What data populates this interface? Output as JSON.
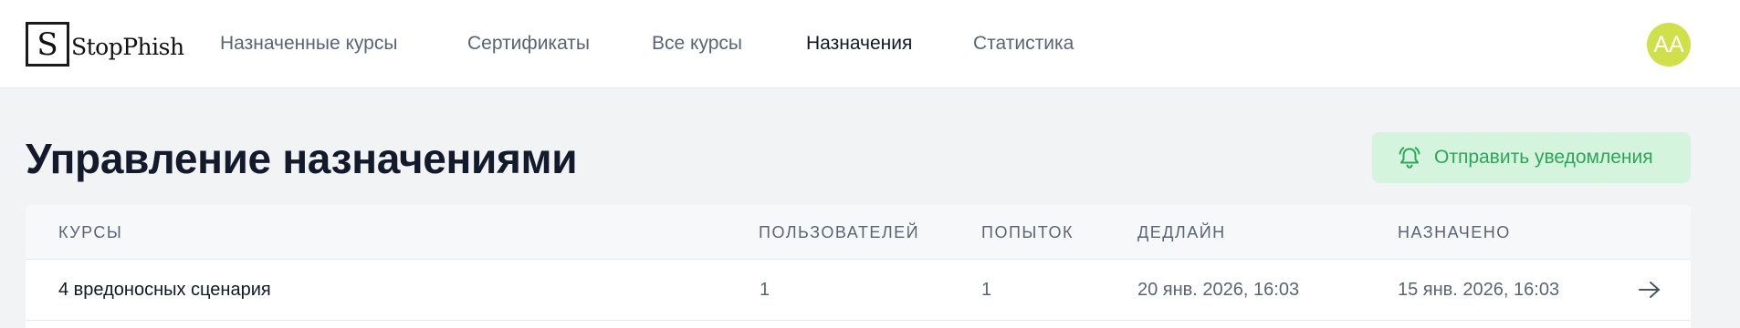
{
  "header": {
    "logo": {
      "letter": "S",
      "text": "StopPhish"
    },
    "nav": [
      {
        "label": "Назначенные курсы",
        "active": false
      },
      {
        "label": "Сертификаты",
        "active": false
      },
      {
        "label": "Все курсы",
        "active": false
      },
      {
        "label": "Назначения",
        "active": true
      },
      {
        "label": "Статистика",
        "active": false
      }
    ],
    "avatar_initials": "AA"
  },
  "page": {
    "title": "Управление назначениями",
    "notify_button": {
      "label": "Отправить уведомления",
      "icon": "bell-icon"
    }
  },
  "table": {
    "columns": [
      "КУРСЫ",
      "ПОЛЬЗОВАТЕЛЕЙ",
      "ПОПЫТОК",
      "ДЕДЛАЙН",
      "НАЗНАЧЕНО"
    ],
    "rows": [
      {
        "course": "4 вредоносных сценария",
        "users": "1",
        "attempts": "1",
        "deadline": "20 янв. 2026, 16:03",
        "assigned": "15 янв. 2026, 16:03",
        "action_icon": "arrow-right-icon"
      }
    ]
  },
  "colors": {
    "accent_green": "#2ea65a",
    "accent_green_bg": "#d5f4de",
    "avatar_bg": "#cfe04a"
  }
}
